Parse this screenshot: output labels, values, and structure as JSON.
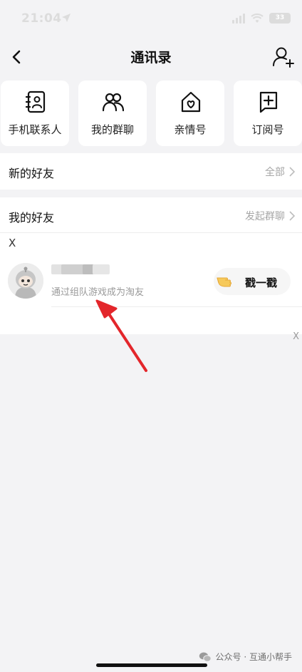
{
  "status_bar": {
    "time": "21:04",
    "battery": "33"
  },
  "nav": {
    "title": "通讯录"
  },
  "quick_entries": [
    {
      "label": "手机联系人",
      "icon": "contacts-book-icon"
    },
    {
      "label": "我的群聊",
      "icon": "group-chat-icon"
    },
    {
      "label": "亲情号",
      "icon": "family-home-icon"
    },
    {
      "label": "订阅号",
      "icon": "subscribe-plus-icon"
    }
  ],
  "new_friends": {
    "title": "新的好友",
    "action": "全部"
  },
  "my_friends": {
    "title": "我的好友",
    "action": "发起群聊",
    "section_index": "X",
    "friend": {
      "subtitle": "通过组队游戏成为淘友",
      "poke_label": "戳一戳"
    }
  },
  "close_label": "X",
  "watermark": "公众号 · 互通小帮手",
  "colors": {
    "accent_arrow": "#e3262b",
    "background": "#f3f3f5",
    "card": "#ffffff",
    "muted_text": "#a6a6a6"
  }
}
